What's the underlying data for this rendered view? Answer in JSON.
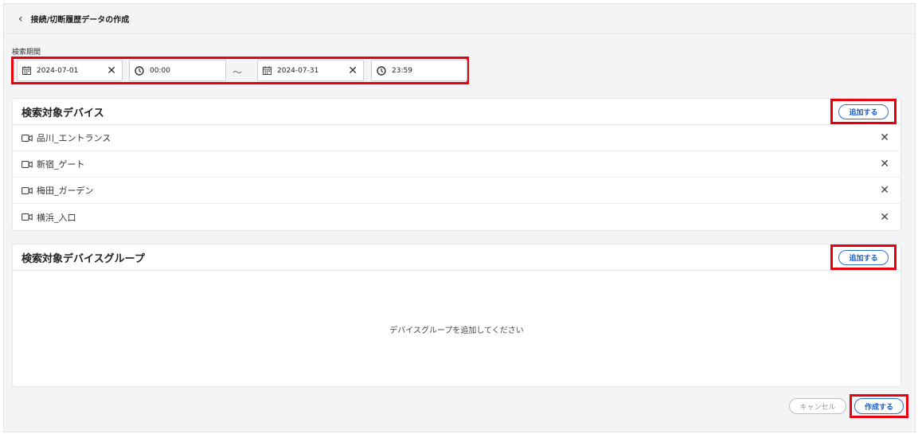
{
  "header": {
    "title": "接続/切断履歴データの作成"
  },
  "period": {
    "label": "検索期間",
    "start_date": "2024-07-01",
    "start_time": "00:00",
    "separator": "～",
    "end_date": "2024-07-31",
    "end_time": "23:59"
  },
  "devices": {
    "title": "検索対象デバイス",
    "add_label": "追加する",
    "items": [
      {
        "name": "品川_エントランス"
      },
      {
        "name": "新宿_ゲート"
      },
      {
        "name": "梅田_ガーデン"
      },
      {
        "name": "横浜_入口"
      }
    ]
  },
  "groups": {
    "title": "検索対象デバイスグループ",
    "add_label": "追加する",
    "empty_text": "デバイスグループを追加してください"
  },
  "footer": {
    "cancel_label": "キャンセル",
    "create_label": "作成する"
  },
  "colors": {
    "accent": "#1a5fc7",
    "highlight": "#e8000e"
  }
}
